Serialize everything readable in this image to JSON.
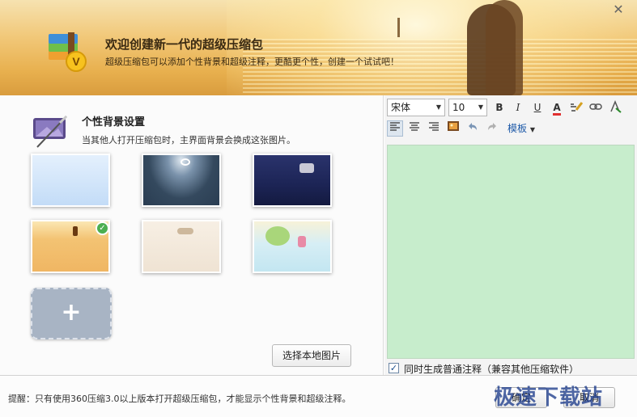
{
  "window": {
    "close_glyph": "✕"
  },
  "header": {
    "title": "欢迎创建新一代的超级压缩包",
    "subtitle": "超级压缩包可以添加个性背景和超级注释，更酷更个性，创建一个试试吧！"
  },
  "background_section": {
    "title": "个性背景设置",
    "description": "当其他人打开压缩包时，主界面背景会换成这张图片。",
    "thumbnails": [
      {
        "name": "light-blue",
        "color": "#cfe4fa",
        "selected": false
      },
      {
        "name": "dark-teal-moon",
        "color": "#34495e",
        "selected": false
      },
      {
        "name": "navy-night",
        "color": "#1c2455",
        "selected": false
      },
      {
        "name": "orange-field",
        "color": "#f0b663",
        "selected": true
      },
      {
        "name": "beige",
        "color": "#efe3d3",
        "selected": false
      },
      {
        "name": "cartoon-sky",
        "color": "#cdeaf3",
        "selected": false
      }
    ],
    "add_glyph": "+",
    "local_image_button": "选择本地图片"
  },
  "editor": {
    "font_family": "宋体",
    "font_size": "10",
    "bold": "B",
    "italic": "I",
    "underline": "U",
    "font_color_glyph": "A",
    "template_label": "模板",
    "background_color": "#c7edcc",
    "compat_checked": true,
    "compat_label": "同时生成普通注释（兼容其他压缩软件）"
  },
  "footer": {
    "tip": "提醒：只有使用360压缩3.0以上版本打开超级压缩包，才能显示个性背景和超级注释。",
    "confirm_button": "确定",
    "cancel_button": "取消",
    "watermark": "极速下载站"
  }
}
